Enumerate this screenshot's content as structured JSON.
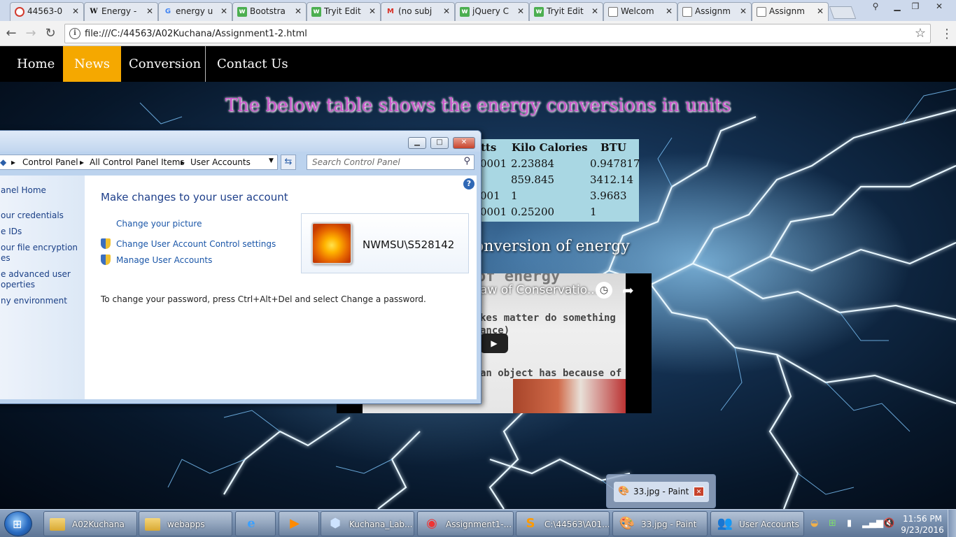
{
  "browser": {
    "tabs": [
      {
        "label": "44563-0",
        "favicon": "loading-icon",
        "color": "#d23b2e"
      },
      {
        "label": "Energy -",
        "favicon": "wikipedia-icon",
        "color": "#333333"
      },
      {
        "label": "energy u",
        "favicon": "google-icon",
        "color": "#4285f4"
      },
      {
        "label": "Bootstra",
        "favicon": "w3schools-icon",
        "color": "#4caf50"
      },
      {
        "label": "Tryit Edit",
        "favicon": "w3schools-icon",
        "color": "#4caf50"
      },
      {
        "label": "(no subj",
        "favicon": "gmail-icon",
        "color": "#d93025"
      },
      {
        "label": "jQuery C",
        "favicon": "w3schools-icon",
        "color": "#4caf50"
      },
      {
        "label": "Tryit Edit",
        "favicon": "w3schools-icon",
        "color": "#4caf50"
      },
      {
        "label": "Welcom",
        "favicon": "page-icon",
        "color": "#777777"
      },
      {
        "label": "Assignm",
        "favicon": "page-icon",
        "color": "#777777"
      },
      {
        "label": "Assignm",
        "favicon": "page-icon",
        "color": "#777777"
      }
    ],
    "url": "file:///C:/44563/A02Kuchana/Assignment1-2.html"
  },
  "page": {
    "nav": [
      {
        "label": "Home",
        "active": false
      },
      {
        "label": "News",
        "active": true
      },
      {
        "label": "Conversion",
        "active": false
      },
      {
        "label": "Contact Us",
        "active": false
      }
    ],
    "heading": "The below table shows the energy conversions in units",
    "table": {
      "headers": [
        "tts",
        "Kilo Calories",
        "BTU"
      ],
      "rows": [
        [
          "0001",
          "2.23884",
          "0.947817"
        ],
        [
          "",
          "859.845",
          "3412.14"
        ],
        [
          "001",
          "1",
          "3.9683"
        ],
        [
          "0001",
          "0.25200",
          "1"
        ]
      ]
    },
    "subheading": "e laws of conversion of energy",
    "video": {
      "title": "aw of Conservatio...",
      "top_text": "of energy",
      "line1": "kes matter do something",
      "line2": "ance)",
      "line3": "an object has because of"
    }
  },
  "control_panel": {
    "breadcrumb": [
      "Control Panel",
      "All Control Panel Items",
      "User Accounts"
    ],
    "search_placeholder": "Search Control Panel",
    "left_links": [
      "anel Home",
      "our credentials",
      "e IDs",
      "our file encryption",
      "es",
      "e advanced user",
      "operties",
      "ny environment"
    ],
    "title": "Make changes to your user account",
    "links": {
      "change_picture": "Change your picture",
      "uac": "Change User Account Control settings",
      "manage": "Manage User Accounts"
    },
    "note": "To change your password, press Ctrl+Alt+Del and select Change a password.",
    "username": "NWMSU\\S528142"
  },
  "paint_popup": {
    "label": "33.jpg - Paint"
  },
  "taskbar": {
    "items": [
      {
        "label": "A02Kuchana",
        "icon": "folder-icon"
      },
      {
        "label": "webapps",
        "icon": "folder-icon"
      },
      {
        "label": "",
        "icon": "ie-icon"
      },
      {
        "label": "",
        "icon": "media-player-icon"
      },
      {
        "label": "Kuchana_Lab...",
        "icon": "virtualbox-icon"
      },
      {
        "label": "Assignment1-...",
        "icon": "chrome-icon"
      },
      {
        "label": "C:\\44563\\A01...",
        "icon": "sublime-icon"
      },
      {
        "label": "33.jpg - Paint",
        "icon": "paint-icon"
      },
      {
        "label": "User Accounts",
        "icon": "user-accounts-icon"
      }
    ],
    "time": "11:56 PM",
    "date": "9/23/2016"
  }
}
